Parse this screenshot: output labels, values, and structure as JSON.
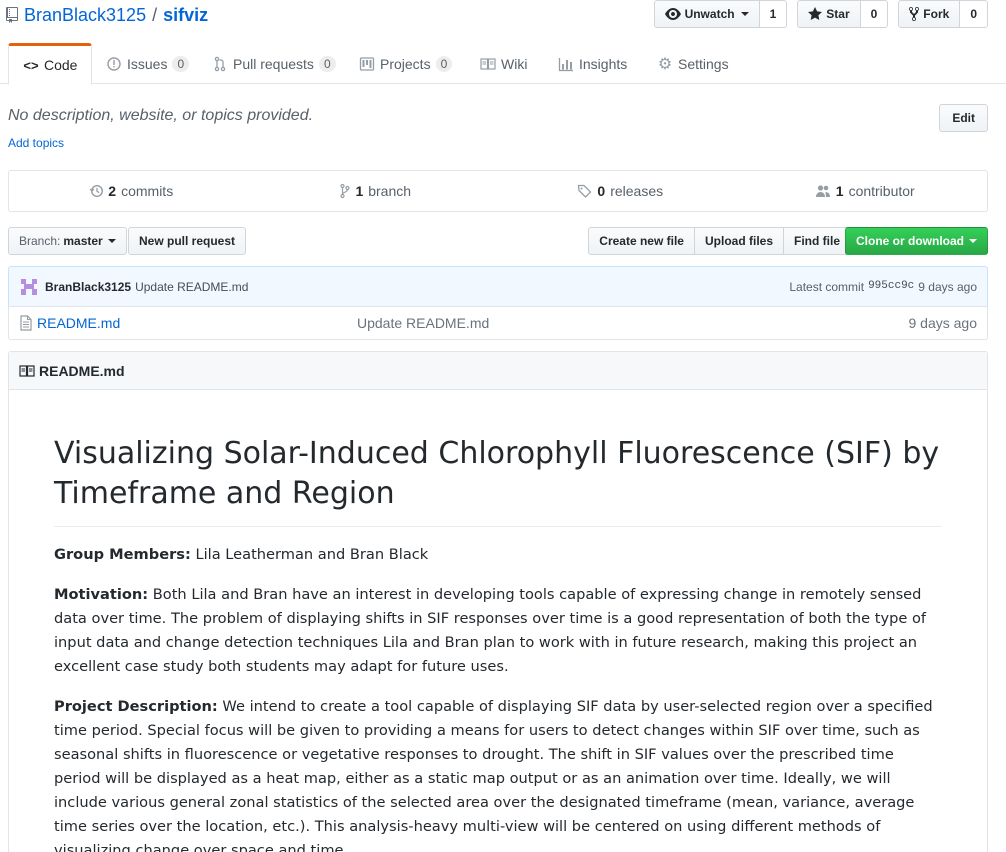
{
  "repo": {
    "owner": "BranBlack3125",
    "separator": "/",
    "name": "sifviz"
  },
  "actions": {
    "watch_label": "Unwatch",
    "watch_count": "1",
    "star_label": "Star",
    "star_count": "0",
    "fork_label": "Fork",
    "fork_count": "0"
  },
  "tabs": [
    {
      "label": "Code",
      "icon": "code-icon"
    },
    {
      "label": "Issues",
      "count": "0",
      "icon": "issue-icon"
    },
    {
      "label": "Pull requests",
      "count": "0",
      "icon": "pull-request-icon"
    },
    {
      "label": "Projects",
      "count": "0",
      "icon": "project-icon"
    },
    {
      "label": "Wiki",
      "icon": "book-icon"
    },
    {
      "label": "Insights",
      "icon": "graph-icon"
    },
    {
      "label": "Settings",
      "icon": "gear-icon"
    }
  ],
  "about": {
    "description": "No description, website, or topics provided.",
    "add_topics": "Add topics",
    "edit_label": "Edit"
  },
  "summary": {
    "commits_num": "2",
    "commits_label": "commits",
    "branch_num": "1",
    "branch_label": "branch",
    "releases_num": "0",
    "releases_label": "releases",
    "contributor_num": "1",
    "contributor_label": "contributor"
  },
  "file_nav": {
    "branch_prefix": "Branch:",
    "branch_name": "master",
    "new_pr": "New pull request",
    "create_file": "Create new file",
    "upload_files": "Upload files",
    "find_file": "Find file",
    "clone": "Clone or download"
  },
  "commit": {
    "author": "BranBlack3125",
    "message": "Update README.md",
    "latest_label": "Latest commit",
    "sha": "995cc9c",
    "age": "9 days ago"
  },
  "files": [
    {
      "name": "README.md",
      "message": "Update README.md",
      "age": "9 days ago"
    }
  ],
  "readme": {
    "header": "README.md",
    "title": "Visualizing Solar-Induced Chlorophyll Fluorescence (SIF) by Timeframe and Region",
    "group_label": "Group Members:",
    "group_text": "Lila Leatherman and Bran Black",
    "motivation_label": "Motivation:",
    "motivation_text": "Both Lila and Bran have an interest in developing tools capable of expressing change in remotely sensed data over time. The problem of displaying shifts in SIF responses over time is a good representation of both the type of input data and change detection techniques Lila and Bran plan to work with in future research, making this project an excellent case study both students may adapt for future uses.",
    "description_label": "Project Description:",
    "description_text": "We intend to create a tool capable of displaying SIF data by user-selected region over a specified time period. Special focus will be given to providing a means for users to detect changes within SIF over time, such as seasonal shifts in fluorescence or vegetative responses to drought. The shift in SIF values over the prescribed time period will be displayed as a heat map, either as a static map output or as an animation over time. Ideally, we will include various general zonal statistics of the selected area over the designated timeframe (mean, variance, average time series over the location, etc.). This analysis-heavy multi-view will be centered on using different methods of visualizing change over space and time."
  },
  "colors": {
    "link": "#0366d6",
    "tab_accent": "#e36209",
    "clone_green": "#28a745",
    "commit_bg": "#f1f8ff"
  }
}
